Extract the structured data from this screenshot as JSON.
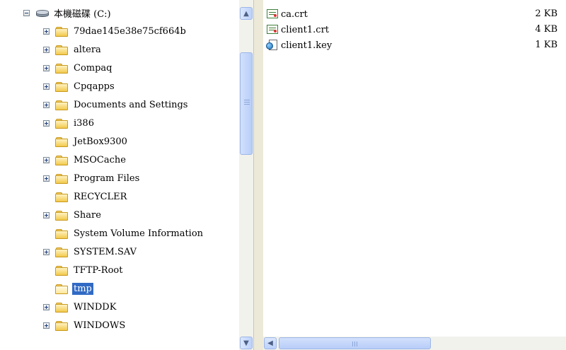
{
  "tree": {
    "items": [
      {
        "label": "本機磁碟 (C:)",
        "icon": "drive-icon",
        "expander": "minus",
        "level": 0
      },
      {
        "label": "79dae145e38e75cf664b",
        "icon": "folder-icon",
        "expander": "plus",
        "level": 1
      },
      {
        "label": "altera",
        "icon": "folder-icon",
        "expander": "plus",
        "level": 1
      },
      {
        "label": "Compaq",
        "icon": "folder-icon",
        "expander": "plus",
        "level": 1
      },
      {
        "label": "Cpqapps",
        "icon": "folder-icon",
        "expander": "plus",
        "level": 1
      },
      {
        "label": "Documents and Settings",
        "icon": "folder-icon",
        "expander": "plus",
        "level": 1
      },
      {
        "label": "i386",
        "icon": "folder-icon",
        "expander": "plus",
        "level": 1
      },
      {
        "label": "JetBox9300",
        "icon": "folder-icon",
        "expander": "none",
        "level": 1
      },
      {
        "label": "MSOCache",
        "icon": "folder-icon",
        "expander": "plus",
        "level": 1
      },
      {
        "label": "Program Files",
        "icon": "folder-icon",
        "expander": "plus",
        "level": 1
      },
      {
        "label": "RECYCLER",
        "icon": "folder-icon",
        "expander": "none",
        "level": 1
      },
      {
        "label": "Share",
        "icon": "folder-icon",
        "expander": "plus",
        "level": 1
      },
      {
        "label": "System Volume Information",
        "icon": "folder-icon",
        "expander": "none",
        "level": 1
      },
      {
        "label": "SYSTEM.SAV",
        "icon": "folder-icon",
        "expander": "plus",
        "level": 1
      },
      {
        "label": "TFTP-Root",
        "icon": "folder-icon",
        "expander": "none",
        "level": 1
      },
      {
        "label": "tmp",
        "icon": "folder-open-icon",
        "expander": "none",
        "level": 1,
        "selected": true
      },
      {
        "label": "WINDDK",
        "icon": "folder-icon",
        "expander": "plus",
        "level": 1
      },
      {
        "label": "WINDOWS",
        "icon": "folder-icon",
        "expander": "plus",
        "level": 1
      }
    ]
  },
  "files": [
    {
      "name": "ca.crt",
      "size": "2 KB",
      "icon": "certificate-icon"
    },
    {
      "name": "client1.crt",
      "size": "4 KB",
      "icon": "certificate-icon"
    },
    {
      "name": "client1.key",
      "size": "1 KB",
      "icon": "key-file-icon"
    }
  ],
  "scrollbar": {
    "up_arrow": "▲",
    "down_arrow": "▼",
    "left_arrow": "◀"
  },
  "colors": {
    "selection": "#316ac5",
    "scroll_face": "#c1d3fb"
  }
}
